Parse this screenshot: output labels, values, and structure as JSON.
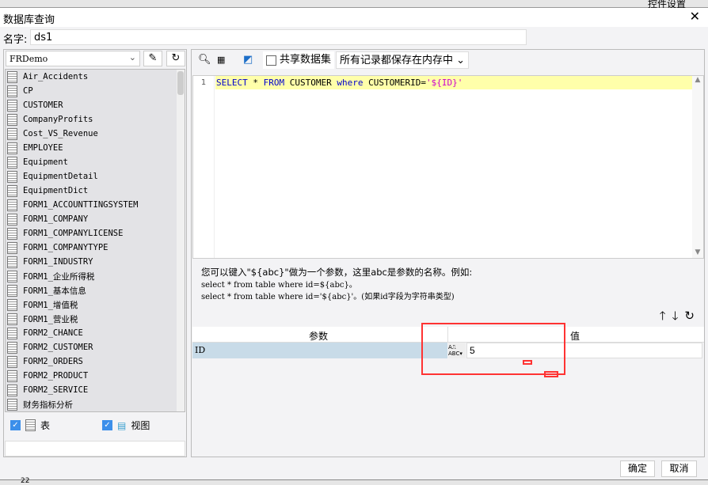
{
  "top_right_label": "控件设置",
  "dialog": {
    "title": "数据库查询",
    "close": "✕"
  },
  "name": {
    "label": "名字:",
    "value": "ds1"
  },
  "connection": {
    "selected": "FRDemo"
  },
  "tables": [
    "Air_Accidents",
    "CP",
    "CUSTOMER",
    "CompanyProfits",
    "Cost_VS_Revenue",
    "EMPLOYEE",
    "Equipment",
    "EquipmentDetail",
    "EquipmentDict",
    "FORM1_ACCOUNTTINGSYSTEM",
    "FORM1_COMPANY",
    "FORM1_COMPANYLICENSE",
    "FORM1_COMPANYTYPE",
    "FORM1_INDUSTRY",
    "FORM1_企业所得税",
    "FORM1_基本信息",
    "FORM1_增值税",
    "FORM1_营业税",
    "FORM2_CHANCE",
    "FORM2_CUSTOMER",
    "FORM2_ORDERS",
    "FORM2_PRODUCT",
    "FORM2_SERVICE",
    "财务指标分析"
  ],
  "filters": {
    "table_label": "表",
    "view_label": "视图"
  },
  "toolbar": {
    "share_label": "共享数据集",
    "storage_option": "所有记录都保存在内存中"
  },
  "sql": {
    "line_no": "1",
    "kw1": "SELECT",
    "t1": " * ",
    "kw2": "FROM",
    "t2": " CUSTOMER ",
    "kw3": "where",
    "t3": " CUSTOMERID=",
    "str": "'${ID}'"
  },
  "help": {
    "line1": "您可以键入\"${abc}\"做为一个参数，这里abc是参数的名称。例如:",
    "line2": "select * from table where id=${abc}。",
    "line3": "select * from table where id='${abc}'。(如果id字段为字符串类型)"
  },
  "params": {
    "col_param": "参数",
    "col_value": "值",
    "rows": [
      {
        "name": "ID",
        "value": "5"
      }
    ]
  },
  "buttons": {
    "ok": "确定",
    "cancel": "取消"
  },
  "footer_number": "22"
}
